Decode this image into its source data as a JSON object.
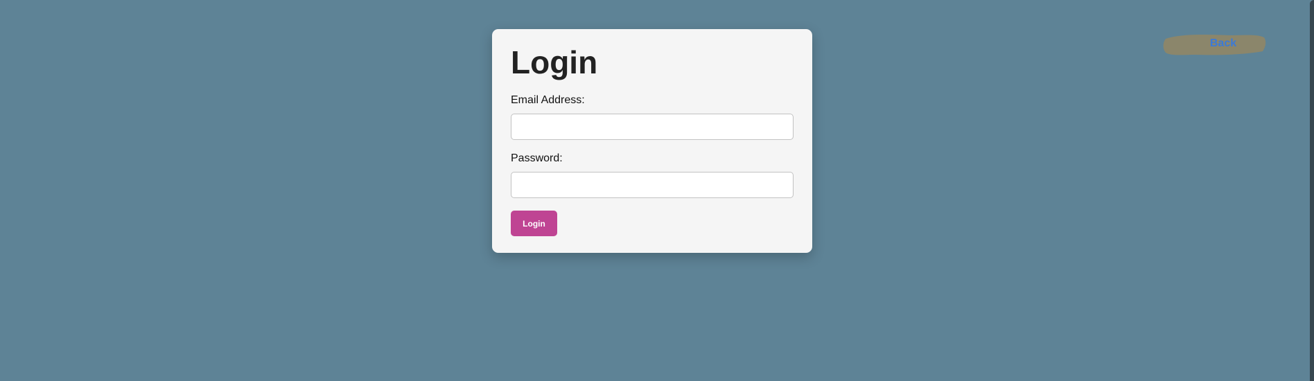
{
  "login_form": {
    "title": "Login",
    "email_label": "Email Address:",
    "email_value": "",
    "password_label": "Password:",
    "password_value": "",
    "submit_label": "Login"
  },
  "nav": {
    "back_label": "Back"
  },
  "colors": {
    "page_background": "#5e8396",
    "card_background": "#f5f5f5",
    "login_button": "#bf4493",
    "back_brush": "#8d8668",
    "back_text": "#3c7ad6"
  }
}
